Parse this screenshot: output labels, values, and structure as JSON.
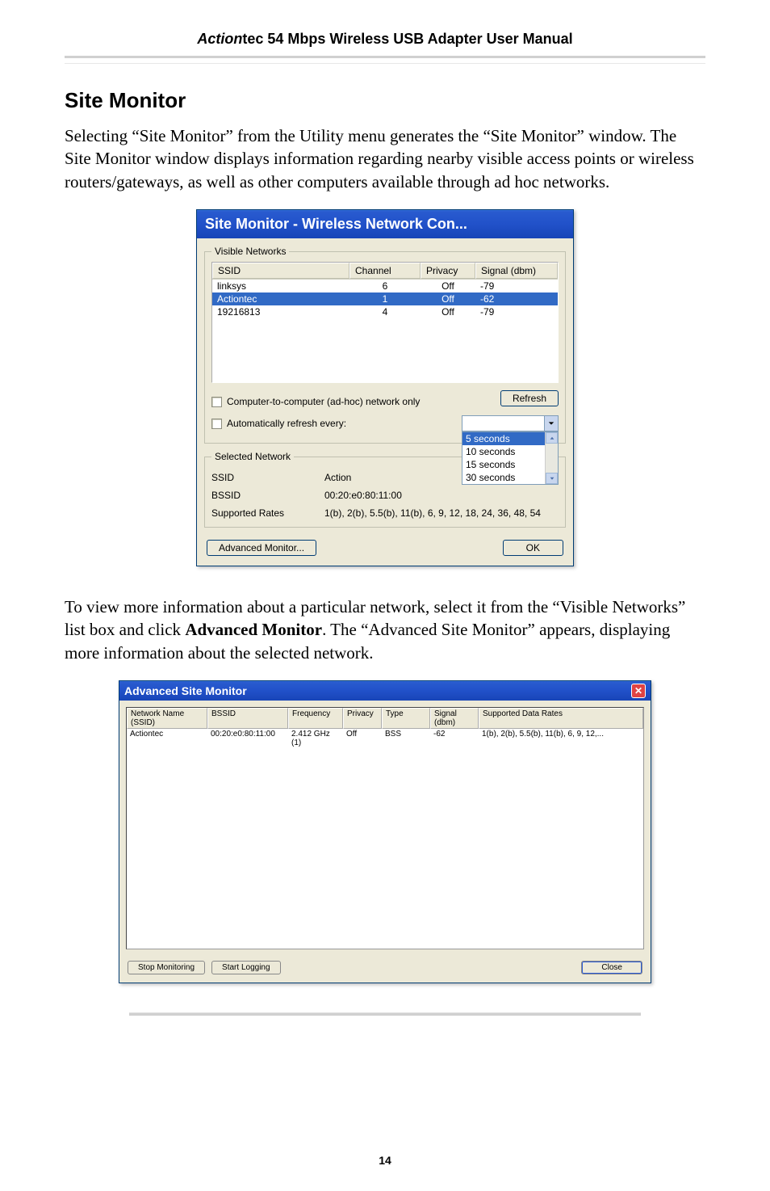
{
  "header": {
    "brand_italic": "Action",
    "brand_rest": "tec 54 Mbps Wireless USB Adapter User Manual"
  },
  "section_title": "Site Monitor",
  "para1": "Selecting “Site Monitor” from the Utility menu generates the “Site Monitor” window. The Site Monitor window displays information regarding nearby visible access points or wireless routers/gateways, as well as other computers available through ad hoc networks.",
  "win1": {
    "title": "Site Monitor - Wireless Network Con...",
    "group_label": "Visible Networks",
    "cols": {
      "ssid": "SSID",
      "channel": "Channel",
      "privacy": "Privacy",
      "signal": "Signal (dbm)"
    },
    "rows": [
      {
        "ssid": "linksys",
        "channel": "6",
        "privacy": "Off",
        "signal": "-79"
      },
      {
        "ssid": "Actiontec",
        "channel": "1",
        "privacy": "Off",
        "signal": "-62",
        "selected": true
      },
      {
        "ssid": "19216813",
        "channel": "4",
        "privacy": "Off",
        "signal": "-79"
      }
    ],
    "adhoc_label": "Computer-to-computer (ad-hoc) network only",
    "refresh_btn": "Refresh",
    "auto_label": "Automatically refresh every:",
    "dd_items": [
      "5 seconds",
      "10 seconds",
      "15 seconds",
      "30 seconds"
    ],
    "dd_selected_index": 0,
    "selected_group": "Selected Network",
    "ssid_lbl": "SSID",
    "ssid_val_prefix": "Action",
    "bssid_lbl": "BSSID",
    "bssid_val": "00:20:e0:80:11:00",
    "rates_lbl": "Supported Rates",
    "rates_val": "1(b), 2(b), 5.5(b), 11(b), 6, 9, 12, 18, 24, 36, 48, 54",
    "adv_btn": "Advanced Monitor...",
    "ok_btn": "OK"
  },
  "para2_pre": "To view more information about a particular network, select it from the “Visible Networks” list box and click ",
  "para2_bold": "Advanced Monitor",
  "para2_post": ". The “Advanced Site Monitor” appears, displaying more information about the selected network.",
  "win2": {
    "title": "Advanced Site Monitor",
    "cols": {
      "name": "Network Name (SSID)",
      "bssid": "BSSID",
      "freq": "Frequency",
      "priv": "Privacy",
      "type": "Type",
      "signal": "Signal (dbm)",
      "rates": "Supported Data Rates"
    },
    "row": {
      "name": "Actiontec",
      "bssid": "00:20:e0:80:11:00",
      "freq": "2.412 GHz (1)",
      "priv": "Off",
      "type": "BSS",
      "signal": "-62",
      "rates": "1(b), 2(b), 5.5(b), 11(b), 6, 9, 12,..."
    },
    "stop_btn": "Stop Monitoring",
    "log_btn": "Start Logging",
    "close_btn": "Close"
  },
  "page_number": "14"
}
